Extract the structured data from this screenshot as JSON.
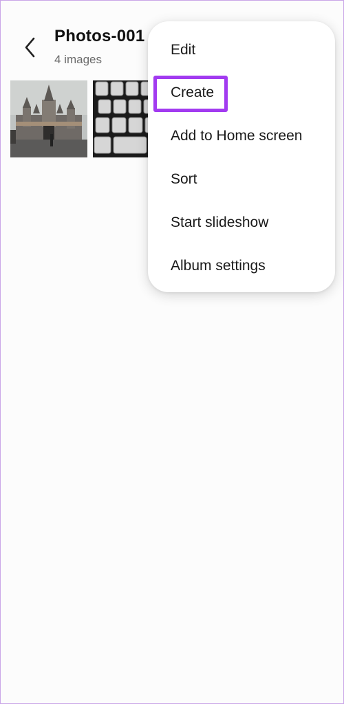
{
  "header": {
    "title": "Photos-001",
    "subtitle": "4 images"
  },
  "icons": {
    "back": "chevron-left-icon"
  },
  "thumbnails": [
    {
      "name": "castle-photo"
    },
    {
      "name": "keyboard-photo"
    }
  ],
  "menu": {
    "items": [
      {
        "label": "Edit"
      },
      {
        "label": "Create"
      },
      {
        "label": "Add to Home screen"
      },
      {
        "label": "Sort"
      },
      {
        "label": "Start slideshow"
      },
      {
        "label": "Album settings"
      }
    ],
    "highlighted_item": "Create",
    "highlight_color": "#a23bf0"
  }
}
